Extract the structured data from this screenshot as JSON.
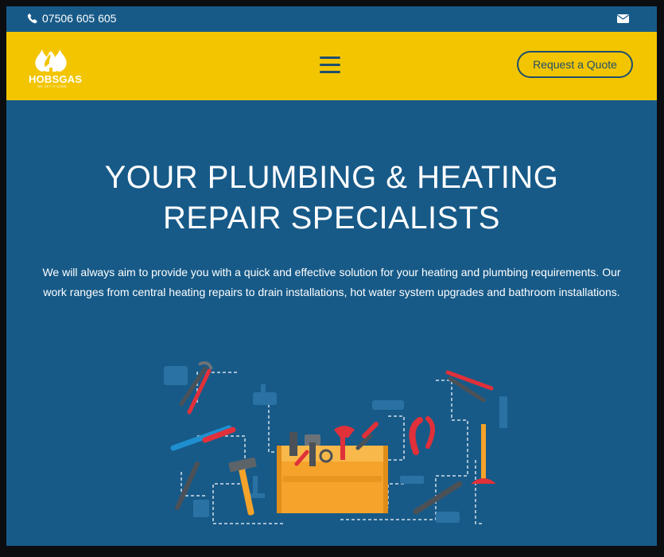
{
  "topbar": {
    "phone": "07506 605 605",
    "phone_icon": "phone-icon",
    "mail_icon": "envelope-icon"
  },
  "header": {
    "logo_name": "HOBSGAS",
    "logo_tagline": "WE GET IT DONE",
    "menu_icon": "hamburger-menu-icon",
    "quote_button": "Request a Quote"
  },
  "hero": {
    "title_line1": "YOUR PLUMBING & HEATING",
    "title_line2": "REPAIR SPECIALISTS",
    "text": "We will always aim to provide you with a quick and effective solution for your heating and plumbing requirements. Our work ranges from central heating repairs to drain installations, hot water system upgrades and bathroom installations.",
    "illustration": "toolbox-with-tools-illustration"
  },
  "colors": {
    "page_blue": "#175a88",
    "header_yellow": "#f2c500",
    "button_navy": "#1f4e6e",
    "toolbox_orange": "#f5a32a",
    "tool_red": "#e0303a"
  }
}
